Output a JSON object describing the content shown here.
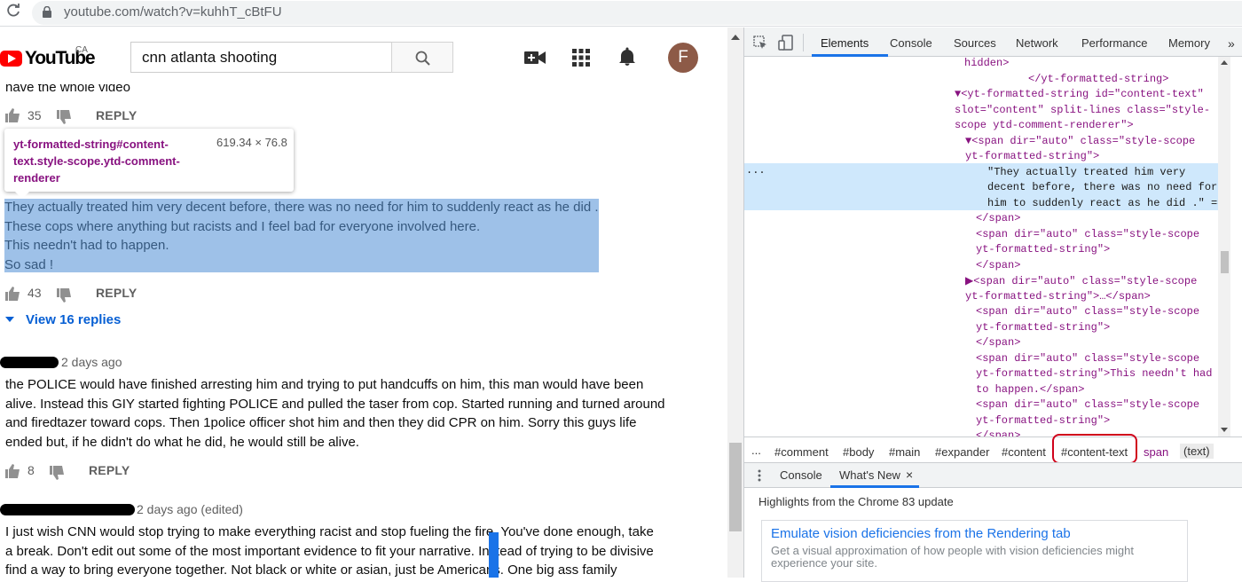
{
  "browser": {
    "url": "youtube.com/watch?v=kuhhT_cBtFU"
  },
  "youtube": {
    "logo_text": "YouTube",
    "region": "CA",
    "search_value": "cnn atlanta shooting",
    "avatar_letter": "F",
    "comments": [
      {
        "text_lines": [
          "have the whole video"
        ],
        "likes": "35",
        "reply_label": "REPLY"
      },
      {
        "text_lines": [
          "They actually treated him very decent before, there was no need for him to suddenly react as he did .",
          "These cops where anything but racists and I feel bad for everyone involved here.",
          "This  needn't had to happen.",
          "So sad !"
        ],
        "likes": "43",
        "reply_label": "REPLY",
        "view_replies": "View 16 replies"
      },
      {
        "timestamp": "2 days ago",
        "text_lines": [
          "the POLICE would have finished arresting him and trying to put handcuffs on him, this man would have been",
          "alive. Instead this GIY started fighting POLICE and pulled the taser from cop. Started running and turned around",
          "and firedtazer toward cops. Then 1police officer shot him and then they did CPR  on him.  Sorry this guys life",
          "ended but, if he didn't do what he did, he would still be alive."
        ],
        "likes": "8",
        "reply_label": "REPLY"
      },
      {
        "timestamp": "2 days ago (edited)",
        "text_lines": [
          "I just wish CNN would stop trying to make everything racist and stop fueling the fire. You've done enough, take",
          "a break. Don't edit out some of the most important evidence to fit your narrative. Instead of trying to be divisive",
          "find a way to bring everyone together. Not black or white or asian, just be Americans. One big ass family"
        ]
      }
    ],
    "inspect_tooltip": {
      "selector": "yt-formatted-string#content-text.style-scope.ytd-comment-renderer",
      "size": "619.34 × 76.8"
    }
  },
  "devtools": {
    "tabs": [
      "Elements",
      "Console",
      "Sources",
      "Network",
      "Performance",
      "Memory"
    ],
    "more": "»",
    "code_lines": [
      {
        "indent": 0,
        "text": "hidden>"
      },
      {
        "indent": 1,
        "text": "</yt-formatted-string>"
      },
      {
        "indent": 2,
        "text": "▼<yt-formatted-string id=\"content-text\""
      },
      {
        "indent": 3,
        "text": "slot=\"content\" split-lines class=\"style-"
      },
      {
        "indent": 3,
        "text": "scope ytd-comment-renderer\">"
      },
      {
        "indent": 4,
        "text": "▼<span dir=\"auto\" class=\"style-scope"
      },
      {
        "indent": 3,
        "text": "yt-formatted-string\">"
      },
      {
        "indent": 5,
        "text": "\"They actually treated him very"
      },
      {
        "indent": 5,
        "text": "decent before, there was no need for"
      },
      {
        "indent": 5,
        "text": "him to suddenly react as he did .\" =="
      },
      {
        "indent": 4,
        "text": "</span>"
      },
      {
        "indent": 4,
        "text": "<span dir=\"auto\" class=\"style-scope"
      },
      {
        "indent": 4,
        "text": "yt-formatted-string\">"
      },
      {
        "indent": 4,
        "text": "</span>"
      },
      {
        "indent": 4,
        "text": "▶<span dir=\"auto\" class=\"style-scope"
      },
      {
        "indent": 3,
        "text": "yt-formatted-string\">…</span>"
      },
      {
        "indent": 4,
        "text": "<span dir=\"auto\" class=\"style-scope"
      },
      {
        "indent": 4,
        "text": "yt-formatted-string\">"
      },
      {
        "indent": 4,
        "text": "</span>"
      },
      {
        "indent": 4,
        "text": "<span dir=\"auto\" class=\"style-scope"
      },
      {
        "indent": 4,
        "text": "yt-formatted-string\">This  needn't had"
      },
      {
        "indent": 4,
        "text": "to happen.</span>"
      },
      {
        "indent": 4,
        "text": "<span dir=\"auto\" class=\"style-scope"
      },
      {
        "indent": 4,
        "text": "yt-formatted-string\">"
      },
      {
        "indent": 4,
        "text": "</span>"
      }
    ],
    "selected_dots": "...",
    "breadcrumbs": [
      "...",
      "#comment",
      "#body",
      "#main",
      "#expander",
      "#content",
      "#content-text",
      "span",
      "(text)"
    ],
    "drawer_tabs": [
      "Console",
      "What's New"
    ],
    "drawer_close": "×",
    "highlights": "Highlights from the Chrome 83 update",
    "card_title": "Emulate vision deficiencies from the Rendering tab",
    "card_desc": "Get a visual approximation of how people with vision deficiencies might experience your site.",
    "colors": {
      "selection": "#cfe8fc",
      "tab_underline": "#1a73e8",
      "annotation": "#d0021b",
      "tag": "#881280",
      "attr_name": "#994500",
      "attr_value": "#1a1aa6"
    }
  }
}
